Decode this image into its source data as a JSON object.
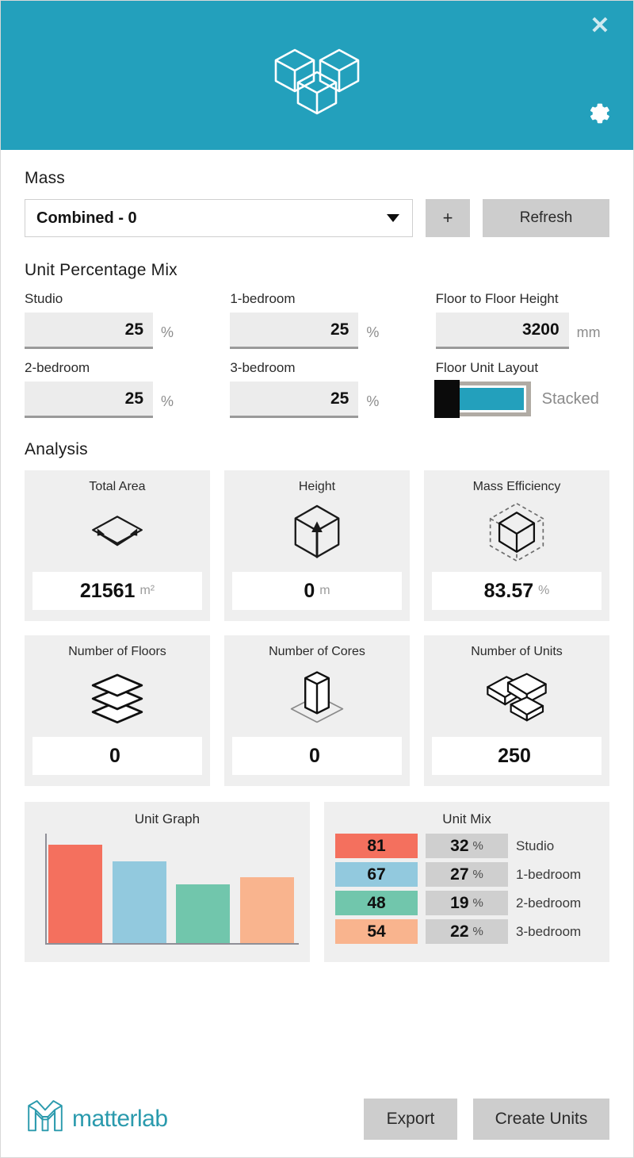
{
  "header": {
    "logo_icon": "three-cubes-icon",
    "close_icon": "close-icon",
    "close_label": "✕",
    "gear_icon": "gear-icon",
    "accent_color": "#23A0BC"
  },
  "mass": {
    "section_label": "Mass",
    "selected": "Combined - 0",
    "add_label": "+",
    "refresh_label": "Refresh"
  },
  "unit_mix_inputs": {
    "section_label": "Unit Percentage Mix",
    "fields": [
      {
        "label": "Studio",
        "value": "25",
        "unit": "%"
      },
      {
        "label": "1-bedroom",
        "value": "25",
        "unit": "%"
      },
      {
        "label": "2-bedroom",
        "value": "25",
        "unit": "%"
      },
      {
        "label": "3-bedroom",
        "value": "25",
        "unit": "%"
      }
    ],
    "floor_height": {
      "label": "Floor to Floor Height",
      "value": "3200",
      "unit": "mm"
    },
    "floor_layout": {
      "label": "Floor Unit Layout",
      "state": "Stacked"
    }
  },
  "analysis": {
    "section_label": "Analysis",
    "cards": [
      {
        "title": "Total Area",
        "icon": "area-diamond-arrow-icon",
        "value": "21561",
        "unit": "m²"
      },
      {
        "title": "Height",
        "icon": "cube-up-arrow-icon",
        "value": "0",
        "unit": "m"
      },
      {
        "title": "Mass Efficiency",
        "icon": "dashed-cube-icon",
        "value": "83.57",
        "unit": "%"
      },
      {
        "title": "Number of Floors",
        "icon": "stacked-plates-icon",
        "value": "0",
        "unit": ""
      },
      {
        "title": "Number of Cores",
        "icon": "core-column-icon",
        "value": "0",
        "unit": ""
      },
      {
        "title": "Number of Units",
        "icon": "stacked-boxes-icon",
        "value": "250",
        "unit": ""
      }
    ]
  },
  "chart_data": {
    "type": "bar",
    "title": "Unit Graph",
    "categories": [
      "Studio",
      "1-bedroom",
      "2-bedroom",
      "3-bedroom"
    ],
    "values": [
      81,
      67,
      48,
      54
    ],
    "colors": [
      "#F4705E",
      "#92C9DE",
      "#71C6AC",
      "#F9B48E"
    ],
    "xlabel": "",
    "ylabel": "",
    "ylim": [
      0,
      90
    ],
    "grid": false,
    "legend": "none"
  },
  "unit_mix_table": {
    "title": "Unit Mix",
    "rows": [
      {
        "count": "81",
        "pct": "32",
        "sym": "%",
        "name": "Studio",
        "color": "#F4705E"
      },
      {
        "count": "67",
        "pct": "27",
        "sym": "%",
        "name": "1-bedroom",
        "color": "#92C9DE"
      },
      {
        "count": "48",
        "pct": "19",
        "sym": "%",
        "name": "2-bedroom",
        "color": "#71C6AC"
      },
      {
        "count": "54",
        "pct": "22",
        "sym": "%",
        "name": "3-bedroom",
        "color": "#F9B48E"
      }
    ]
  },
  "footer": {
    "brand_icon": "matterlab-m-icon",
    "brand_name": "matterlab",
    "brand_color": "#2A9AAD",
    "export_label": "Export",
    "create_units_label": "Create Units"
  }
}
